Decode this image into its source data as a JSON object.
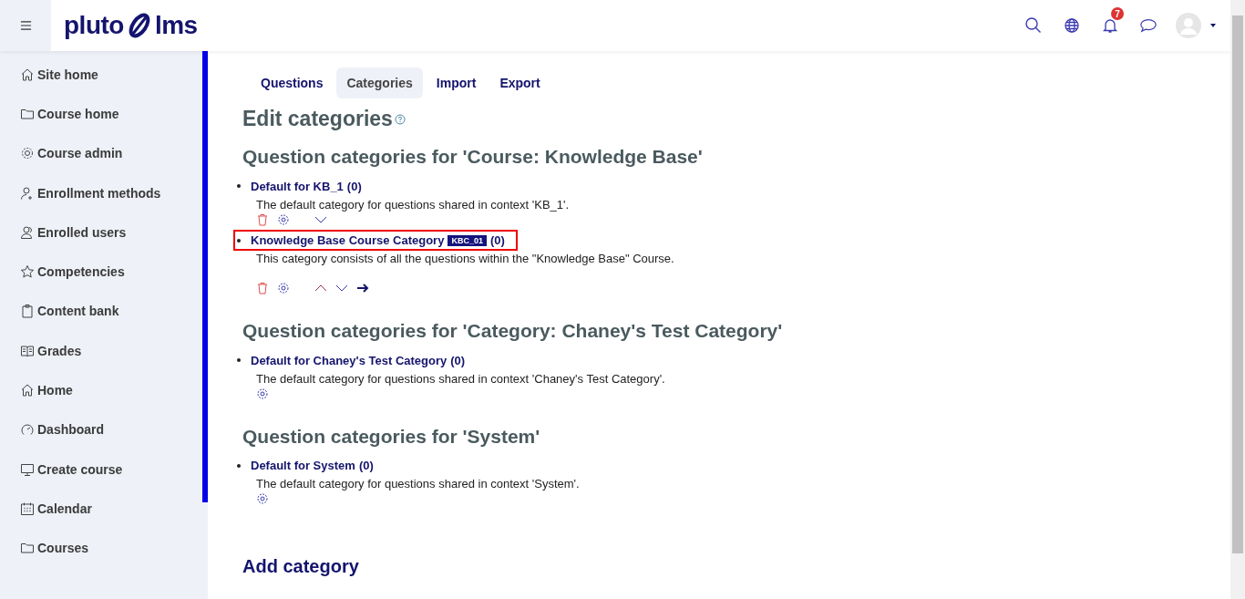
{
  "header": {
    "logo_left": "pluto",
    "logo_right": "lms",
    "notification_count": "7"
  },
  "sidebar": {
    "items": [
      {
        "label": "Site home"
      },
      {
        "label": "Course home"
      },
      {
        "label": "Course admin"
      },
      {
        "label": "Enrollment methods"
      },
      {
        "label": "Enrolled users"
      },
      {
        "label": "Competencies"
      },
      {
        "label": "Content bank"
      },
      {
        "label": "Grades"
      },
      {
        "label": "Home"
      },
      {
        "label": "Dashboard"
      },
      {
        "label": "Create course"
      },
      {
        "label": "Calendar"
      },
      {
        "label": "Courses"
      }
    ]
  },
  "tabs": [
    {
      "label": "Questions",
      "selected": false
    },
    {
      "label": "Categories",
      "selected": true
    },
    {
      "label": "Import",
      "selected": false
    },
    {
      "label": "Export",
      "selected": false
    }
  ],
  "page_title": "Edit categories",
  "contexts": [
    {
      "heading": "Question categories for 'Course: Knowledge Base'",
      "categories": [
        {
          "name": "Default for KB_1",
          "count": "(0)",
          "description": "The default category for questions shared in context 'KB_1'.",
          "highlighted": false,
          "actions": [
            {
              "kind": "delete"
            },
            {
              "kind": "edit"
            },
            {
              "kind": "down"
            }
          ]
        },
        {
          "name": "Knowledge Base Course Category",
          "id_number": "KBC_01",
          "count": "(0)",
          "description": "This category consists of all the questions within the \"Knowledge Base\" Course.",
          "highlighted": true,
          "actions": [
            {
              "kind": "delete"
            },
            {
              "kind": "edit"
            },
            {
              "kind": "up"
            },
            {
              "kind": "down"
            },
            {
              "kind": "move"
            }
          ]
        }
      ]
    },
    {
      "heading": "Question categories for 'Category: Chaney's Test Category'",
      "categories": [
        {
          "name": "Default for Chaney's Test Category",
          "count": "(0)",
          "description": "The default category for questions shared in context 'Chaney's Test Category'.",
          "highlighted": false,
          "actions": [
            {
              "kind": "edit"
            }
          ]
        }
      ]
    },
    {
      "heading": "Question categories for 'System'",
      "categories": [
        {
          "name": "Default for System",
          "count": "(0)",
          "description": "The default category for questions shared in context 'System'.",
          "highlighted": false,
          "actions": [
            {
              "kind": "edit"
            }
          ]
        }
      ]
    }
  ],
  "add_heading": "Add category"
}
